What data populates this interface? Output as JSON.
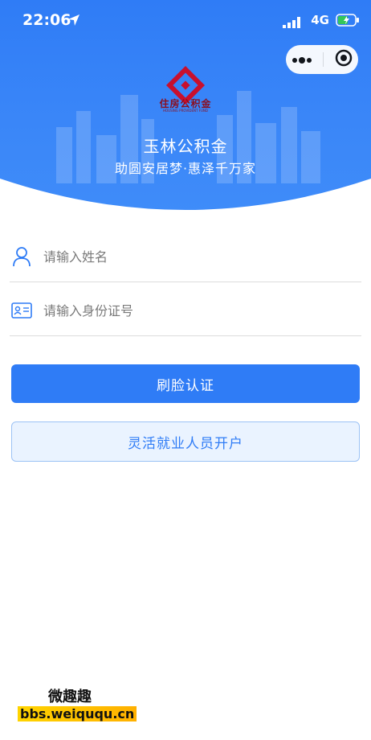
{
  "status_bar": {
    "time": "22:06",
    "network": "4G"
  },
  "capsule": {
    "more_icon": "more-dots-icon",
    "close_icon": "target-circle-icon"
  },
  "brand": {
    "logo_text": "住房公积金",
    "logo_subtext": "HOUSING PROVIDENT FUND"
  },
  "header": {
    "title": "玉林公积金",
    "slogan": "助圆安居梦·惠泽千万家"
  },
  "form": {
    "name_placeholder": "请输入姓名",
    "id_placeholder": "请输入身份证号",
    "name_icon": "user-icon",
    "id_icon": "id-card-icon"
  },
  "actions": {
    "face_auth_label": "刷脸认证",
    "flex_employment_label": "灵活就业人员开户"
  },
  "watermark": {
    "top": "微趣趣",
    "bottom": "bbs.weiququ.cn"
  },
  "colors": {
    "primary": "#2f7cf6",
    "brand_red": "#c8102e"
  }
}
